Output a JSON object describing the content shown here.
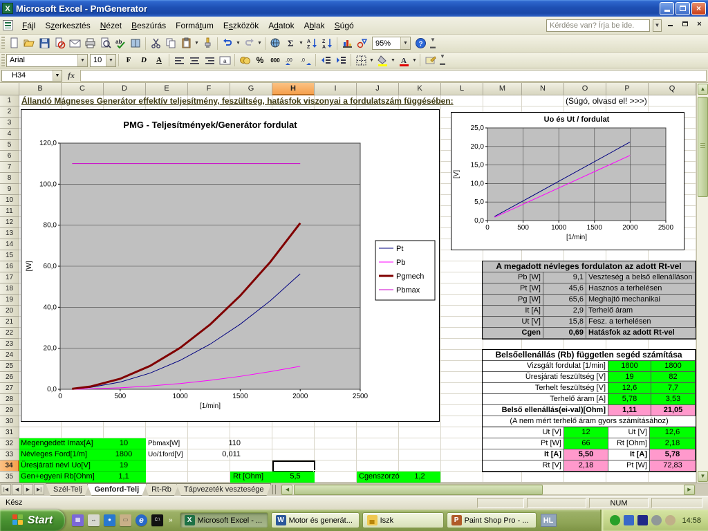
{
  "window": {
    "title": "Microsoft Excel - PmGenerator",
    "question_placeholder": "Kérdése van? Írja be ide."
  },
  "menu_bar": {
    "items": [
      {
        "label": "Fájl",
        "key": "F"
      },
      {
        "label": "Szerkesztés",
        "key": "z"
      },
      {
        "label": "Nézet",
        "key": "N"
      },
      {
        "label": "Beszúrás",
        "key": "B"
      },
      {
        "label": "Formátum",
        "key": "t"
      },
      {
        "label": "Eszközök",
        "key": "s"
      },
      {
        "label": "Adatok",
        "key": "d"
      },
      {
        "label": "Ablak",
        "key": "b"
      },
      {
        "label": "Súgó",
        "key": "S"
      }
    ]
  },
  "toolbars": {
    "font_name": "Arial",
    "font_size": "10",
    "zoom_level": "95%",
    "bold_label": "F",
    "italic_label": "D",
    "underline_label": "A",
    "thousand_label": "000",
    "percent_label": "%",
    "std_icons": [
      "new-document",
      "open-folder",
      "save",
      "permission",
      "email",
      "print",
      "print-preview",
      "spelling",
      "research",
      "cut",
      "copy",
      "paste",
      "format-painter",
      "undo",
      "redo",
      "insert-hyperlink",
      "autosum",
      "sort-ascending",
      "sort-descending",
      "chart-wizard",
      "drawing",
      "help"
    ]
  },
  "formula_bar": {
    "name_box": "H34",
    "fx_label": "fx"
  },
  "sheet": {
    "columns": [
      "B",
      "C",
      "D",
      "E",
      "F",
      "G",
      "H",
      "I",
      "J",
      "K",
      "L",
      "M",
      "N",
      "O",
      "P",
      "Q"
    ],
    "selected_column": "H",
    "row_count": 35,
    "selected_row": 34,
    "selected_cell": "H34",
    "title_text": "Állandó Mágneses Generátor effektív teljesítmény, feszültség, hatásfok viszonyai a fordulatszám függésében:",
    "help_note": "(Súgó, olvasd el! >>>)"
  },
  "rt_table": {
    "title": "A megadott névleges fordulaton az adott Rt-vel",
    "rows": [
      {
        "label": "Pb [W]",
        "value": "9,1",
        "desc": "Veszteség a belső ellenálláson",
        "bold": false
      },
      {
        "label": "Pt [W]",
        "value": "45,6",
        "desc": "Hasznos a terhelésen",
        "bold": false
      },
      {
        "label": "Pg [W]",
        "value": "65,6",
        "desc": "Meghajtó mechanikai",
        "bold": false
      },
      {
        "label": "It [A]",
        "value": "2,9",
        "desc": "Terhelő áram",
        "bold": false
      },
      {
        "label": "Ut [V]",
        "value": "15,8",
        "desc": "Fesz. a terhelésen",
        "bold": false
      },
      {
        "label": "Cgen",
        "value": "0,69",
        "desc": "Hatásfok az adott Rt-vel",
        "bold": true
      }
    ]
  },
  "rb_table": {
    "title": "Belsőellenállás (Rb) független segéd számítása",
    "rows": [
      {
        "label": "Vizsgált fordulat [1/min]",
        "v1": "1800",
        "v2": "1800"
      },
      {
        "label": "Üresjárati feszültség [V]",
        "v1": "19",
        "v2": "82"
      },
      {
        "label": "Terhelt feszültség [V]",
        "v1": "12,6",
        "v2": "7,7"
      },
      {
        "label": "Terhelő áram [A]",
        "v1": "5,78",
        "v2": "3,53"
      }
    ],
    "result": {
      "label": "Belső ellenállás(ei-val)[Ohm]",
      "v1": "1,11",
      "v2": "21,05"
    },
    "note": "(A nem mért terhelő áram gyors számításához)"
  },
  "quick_calc": {
    "rows": [
      {
        "c": [
          "Ut [V]",
          "12",
          "Ut [V]",
          "12,6"
        ],
        "fill": "green",
        "bold": false
      },
      {
        "c": [
          "Pt [W]",
          "66",
          "Rt [Ohm]",
          "2,18"
        ],
        "fill": "green",
        "bold": false
      },
      {
        "c": [
          "It [A]",
          "5,50",
          "It [A]",
          "5,78"
        ],
        "fill": "pink",
        "bold": true
      },
      {
        "c": [
          "Rt [V]",
          "2,18",
          "Pt [W]",
          "72,83"
        ],
        "fill": "pink",
        "bold": false
      }
    ]
  },
  "inputs": {
    "rows": [
      {
        "label": "Megengedett Imax[A]",
        "value": "10"
      },
      {
        "label": "Névleges Ford[1/m]",
        "value": "1800"
      },
      {
        "label": "Üresjárati névl Uo[V]",
        "value": "19"
      },
      {
        "label": "Gen+egyeni Rb[Ohm]",
        "value": "1,1"
      }
    ],
    "pbmax_label": "Pbmax[W]",
    "pbmax_value": "110",
    "uo1ford_label": "Uo/1ford[V]",
    "uo1ford_value": "0,011",
    "rt_label": "Rt [Ohm]",
    "rt_value": "5,5",
    "cgen_label": "Cgenszorzó",
    "cgen_value": "1,2"
  },
  "chart_data": [
    {
      "type": "line",
      "title": "PMG - Teljesítmények/Generátor fordulat",
      "xlabel": "[1/min]",
      "ylabel": "[W]",
      "xlim": [
        0,
        2500
      ],
      "ylim": [
        0,
        120
      ],
      "xticks": [
        0,
        500,
        1000,
        1500,
        2000,
        2500
      ],
      "xtick_labels": [
        "0",
        "500",
        "1000",
        "1500",
        "2000",
        "2500"
      ],
      "yticks": [
        0,
        20,
        40,
        60,
        80,
        100,
        120
      ],
      "ytick_labels": [
        "0,0",
        "20,0",
        "40,0",
        "60,0",
        "80,0",
        "100,0",
        "120,0"
      ],
      "grid": "horizontal",
      "plot_bg": "#C0C0C0",
      "legend_position": "right",
      "x": [
        100,
        250,
        500,
        750,
        1000,
        1250,
        1500,
        1750,
        2000
      ],
      "series": [
        {
          "name": "Pt",
          "color": "#000080",
          "width": 1,
          "values": [
            0.1,
            0.9,
            3.5,
            7.9,
            14.1,
            22.0,
            31.7,
            43.1,
            56.3
          ]
        },
        {
          "name": "Pb",
          "color": "#FF00FF",
          "width": 1,
          "values": [
            0.0,
            0.2,
            0.7,
            1.6,
            2.8,
            4.4,
            6.3,
            8.6,
            11.2
          ]
        },
        {
          "name": "Pgmech",
          "color": "#800000",
          "width": 3,
          "values": [
            0.2,
            1.3,
            5.1,
            11.4,
            20.2,
            31.6,
            45.6,
            62.0,
            81.0
          ]
        },
        {
          "name": "Pbmax",
          "color": "#CC00CC",
          "width": 1,
          "values": [
            110,
            110,
            110,
            110,
            110,
            110,
            110,
            110,
            110
          ]
        }
      ]
    },
    {
      "type": "line",
      "title": "Uo és Ut / fordulat",
      "xlabel": "[1/min]",
      "ylabel": "[V]",
      "xlim": [
        0,
        2500
      ],
      "ylim": [
        0,
        25
      ],
      "xticks": [
        0,
        500,
        1000,
        1500,
        2000,
        2500
      ],
      "xtick_labels": [
        "0",
        "500",
        "1000",
        "1500",
        "2000",
        "2500"
      ],
      "yticks": [
        0,
        5,
        10,
        15,
        20,
        25
      ],
      "ytick_labels": [
        "0,0",
        "5,0",
        "10,0",
        "15,0",
        "20,0",
        "25,0"
      ],
      "grid": "both",
      "plot_bg": "#C0C0C0",
      "legend_position": "none",
      "x": [
        100,
        500,
        1000,
        1500,
        2000
      ],
      "series": [
        {
          "name": "Uo",
          "color": "#000080",
          "width": 1,
          "values": [
            1.1,
            5.3,
            10.6,
            15.9,
            21.2
          ]
        },
        {
          "name": "Ut",
          "color": "#FF00FF",
          "width": 1,
          "values": [
            0.9,
            4.4,
            8.8,
            13.2,
            17.6
          ]
        }
      ]
    }
  ],
  "tab_bar": {
    "tabs": [
      {
        "label": "Szél-Telj",
        "active": false
      },
      {
        "label": "Genford-Telj",
        "active": true
      },
      {
        "label": "Rt-Rb",
        "active": false
      },
      {
        "label": "Tápvezeték vesztesége",
        "active": false
      }
    ]
  },
  "status_bar": {
    "mode": "Kész",
    "num_indicator": "NUM"
  },
  "taskbar": {
    "start_label": "Start",
    "quick_launch": [
      "calculator-icon",
      "show-desktop-icon",
      "messenger-icon",
      "printer-icon",
      "internet-explorer-icon",
      "command-prompt-icon"
    ],
    "tasks": [
      {
        "label": "Microsoft Excel - ...",
        "icon": "excel-icon",
        "active": true
      },
      {
        "label": "Motor és generát...",
        "icon": "word-icon",
        "active": false
      },
      {
        "label": "Iszk",
        "icon": "folder-icon",
        "active": false
      },
      {
        "label": "Paint Shop Pro - ...",
        "icon": "paintshop-icon",
        "active": false
      }
    ],
    "language_indicator": "HL",
    "tray_icons": [
      "antivirus-icon",
      "network-icon",
      "wireless-icon",
      "volume-icon",
      "camera-icon"
    ],
    "clock": "14:58"
  },
  "colors": {
    "green_fill": "#00FF00",
    "pink_fill": "#FF99CC",
    "table_gray": "#C0C0C0",
    "selected_header": "#F5A04C",
    "plot_background": "#C0C0C0"
  }
}
